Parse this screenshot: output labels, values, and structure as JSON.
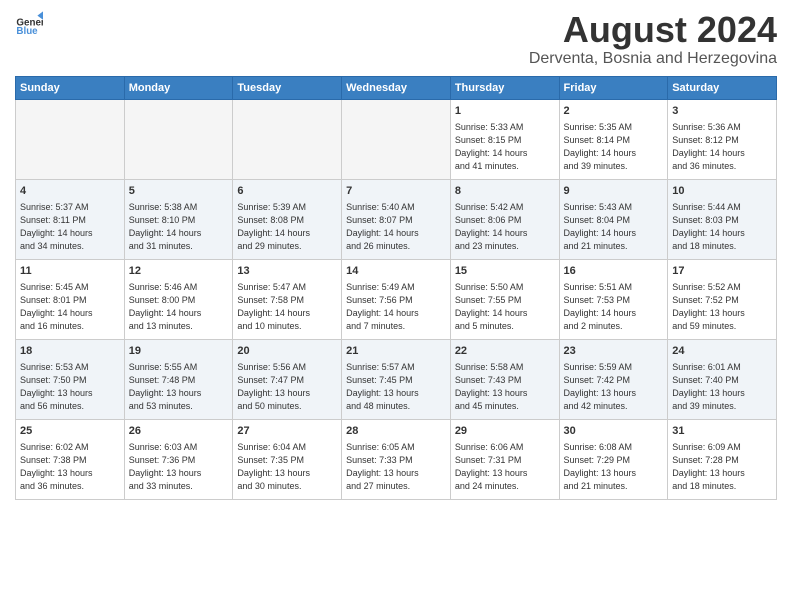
{
  "header": {
    "logo_general": "General",
    "logo_blue": "Blue",
    "title": "August 2024",
    "subtitle": "Derventa, Bosnia and Herzegovina"
  },
  "weekdays": [
    "Sunday",
    "Monday",
    "Tuesday",
    "Wednesday",
    "Thursday",
    "Friday",
    "Saturday"
  ],
  "weeks": [
    [
      {
        "day": "",
        "info": ""
      },
      {
        "day": "",
        "info": ""
      },
      {
        "day": "",
        "info": ""
      },
      {
        "day": "",
        "info": ""
      },
      {
        "day": "1",
        "info": "Sunrise: 5:33 AM\nSunset: 8:15 PM\nDaylight: 14 hours\nand 41 minutes."
      },
      {
        "day": "2",
        "info": "Sunrise: 5:35 AM\nSunset: 8:14 PM\nDaylight: 14 hours\nand 39 minutes."
      },
      {
        "day": "3",
        "info": "Sunrise: 5:36 AM\nSunset: 8:12 PM\nDaylight: 14 hours\nand 36 minutes."
      }
    ],
    [
      {
        "day": "4",
        "info": "Sunrise: 5:37 AM\nSunset: 8:11 PM\nDaylight: 14 hours\nand 34 minutes."
      },
      {
        "day": "5",
        "info": "Sunrise: 5:38 AM\nSunset: 8:10 PM\nDaylight: 14 hours\nand 31 minutes."
      },
      {
        "day": "6",
        "info": "Sunrise: 5:39 AM\nSunset: 8:08 PM\nDaylight: 14 hours\nand 29 minutes."
      },
      {
        "day": "7",
        "info": "Sunrise: 5:40 AM\nSunset: 8:07 PM\nDaylight: 14 hours\nand 26 minutes."
      },
      {
        "day": "8",
        "info": "Sunrise: 5:42 AM\nSunset: 8:06 PM\nDaylight: 14 hours\nand 23 minutes."
      },
      {
        "day": "9",
        "info": "Sunrise: 5:43 AM\nSunset: 8:04 PM\nDaylight: 14 hours\nand 21 minutes."
      },
      {
        "day": "10",
        "info": "Sunrise: 5:44 AM\nSunset: 8:03 PM\nDaylight: 14 hours\nand 18 minutes."
      }
    ],
    [
      {
        "day": "11",
        "info": "Sunrise: 5:45 AM\nSunset: 8:01 PM\nDaylight: 14 hours\nand 16 minutes."
      },
      {
        "day": "12",
        "info": "Sunrise: 5:46 AM\nSunset: 8:00 PM\nDaylight: 14 hours\nand 13 minutes."
      },
      {
        "day": "13",
        "info": "Sunrise: 5:47 AM\nSunset: 7:58 PM\nDaylight: 14 hours\nand 10 minutes."
      },
      {
        "day": "14",
        "info": "Sunrise: 5:49 AM\nSunset: 7:56 PM\nDaylight: 14 hours\nand 7 minutes."
      },
      {
        "day": "15",
        "info": "Sunrise: 5:50 AM\nSunset: 7:55 PM\nDaylight: 14 hours\nand 5 minutes."
      },
      {
        "day": "16",
        "info": "Sunrise: 5:51 AM\nSunset: 7:53 PM\nDaylight: 14 hours\nand 2 minutes."
      },
      {
        "day": "17",
        "info": "Sunrise: 5:52 AM\nSunset: 7:52 PM\nDaylight: 13 hours\nand 59 minutes."
      }
    ],
    [
      {
        "day": "18",
        "info": "Sunrise: 5:53 AM\nSunset: 7:50 PM\nDaylight: 13 hours\nand 56 minutes."
      },
      {
        "day": "19",
        "info": "Sunrise: 5:55 AM\nSunset: 7:48 PM\nDaylight: 13 hours\nand 53 minutes."
      },
      {
        "day": "20",
        "info": "Sunrise: 5:56 AM\nSunset: 7:47 PM\nDaylight: 13 hours\nand 50 minutes."
      },
      {
        "day": "21",
        "info": "Sunrise: 5:57 AM\nSunset: 7:45 PM\nDaylight: 13 hours\nand 48 minutes."
      },
      {
        "day": "22",
        "info": "Sunrise: 5:58 AM\nSunset: 7:43 PM\nDaylight: 13 hours\nand 45 minutes."
      },
      {
        "day": "23",
        "info": "Sunrise: 5:59 AM\nSunset: 7:42 PM\nDaylight: 13 hours\nand 42 minutes."
      },
      {
        "day": "24",
        "info": "Sunrise: 6:01 AM\nSunset: 7:40 PM\nDaylight: 13 hours\nand 39 minutes."
      }
    ],
    [
      {
        "day": "25",
        "info": "Sunrise: 6:02 AM\nSunset: 7:38 PM\nDaylight: 13 hours\nand 36 minutes."
      },
      {
        "day": "26",
        "info": "Sunrise: 6:03 AM\nSunset: 7:36 PM\nDaylight: 13 hours\nand 33 minutes."
      },
      {
        "day": "27",
        "info": "Sunrise: 6:04 AM\nSunset: 7:35 PM\nDaylight: 13 hours\nand 30 minutes."
      },
      {
        "day": "28",
        "info": "Sunrise: 6:05 AM\nSunset: 7:33 PM\nDaylight: 13 hours\nand 27 minutes."
      },
      {
        "day": "29",
        "info": "Sunrise: 6:06 AM\nSunset: 7:31 PM\nDaylight: 13 hours\nand 24 minutes."
      },
      {
        "day": "30",
        "info": "Sunrise: 6:08 AM\nSunset: 7:29 PM\nDaylight: 13 hours\nand 21 minutes."
      },
      {
        "day": "31",
        "info": "Sunrise: 6:09 AM\nSunset: 7:28 PM\nDaylight: 13 hours\nand 18 minutes."
      }
    ]
  ]
}
